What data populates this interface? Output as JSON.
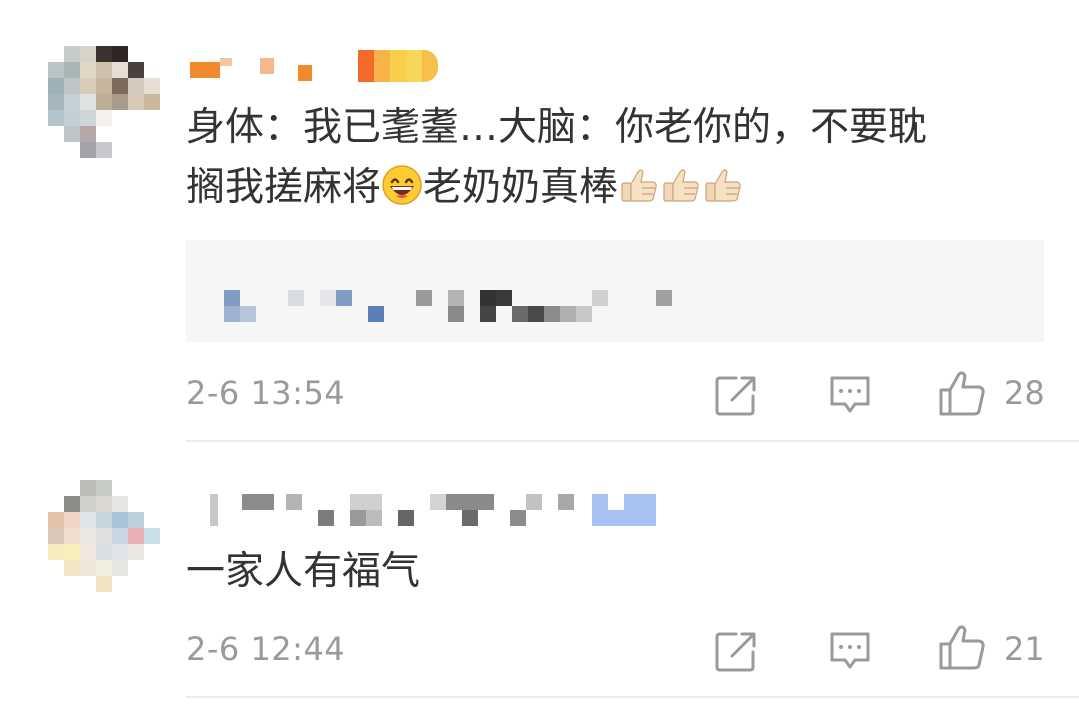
{
  "comments": [
    {
      "text_line1": "身体：我已耄耋…大脑：你老你的，不要耽",
      "text_line2": "搁我搓麻将",
      "text_line2_after": "老奶奶真棒",
      "time": "2-6 13:54",
      "likes": "28",
      "emoji_icons": [
        "grinning-face-icon",
        "thumbs-up-icon",
        "thumbs-up-icon",
        "thumbs-up-icon"
      ]
    },
    {
      "text_line1": "一家人有福气",
      "time": "2-6 12:44",
      "likes": "21"
    }
  ],
  "colors": {
    "text": "#333333",
    "meta": "#9a9a9a",
    "quote_bg": "#f6f6f6",
    "divider": "#ececec"
  }
}
